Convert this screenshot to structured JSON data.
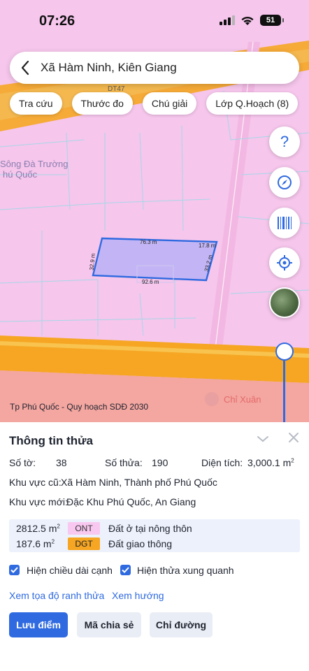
{
  "status": {
    "time": "07:26",
    "battery": "51"
  },
  "search": {
    "text": "Xã Hàm Ninh, Kiên Giang"
  },
  "toolbar": {
    "chips": [
      "Tra cứu",
      "Thước đo",
      "Chú giải",
      "Lớp Q.Hoạch (8)"
    ]
  },
  "map": {
    "road_label": "DT47",
    "area_label_1": "Sông Đà Trường",
    "area_label_2": "hú Quốc",
    "parcel_top": "76.3 m",
    "parcel_top_right": "17.8 m",
    "parcel_left": "32.9 m",
    "parcel_right": "33.2 m",
    "parcel_bottom": "92.6 m",
    "caption": "Tp Phú Quốc - Quy hoạch SDĐ 2030",
    "poi": "Chỉ Xuân",
    "colors": {
      "residential": "#f6c6ec",
      "road": "#f6a623",
      "zone": "#f4a6a0",
      "parcel": "#2f6ae0"
    }
  },
  "panel": {
    "title": "Thông tin thửa",
    "so_to_label": "Số tờ:",
    "so_to_value": "38",
    "so_thua_label": "Số thửa:",
    "so_thua_value": "190",
    "dien_tich_label": "Diện tích:",
    "dien_tich_value": "3,000.1 m",
    "dien_tich_unit_sup": "2",
    "khu_vuc_cu_label": "Khu vực cũ:",
    "khu_vuc_cu_value": "Xã Hàm Ninh, Thành phố Phú Quốc",
    "khu_vuc_moi_label": "Khu vực mới:",
    "khu_vuc_moi_value": "Đặc Khu Phú Quốc, An Giang",
    "land_uses": [
      {
        "area": "2812.5 m",
        "sup": "2",
        "code": "ONT",
        "desc": "Đất ở tại nông thôn",
        "badge_bg": "#f8c8f0",
        "badge_color": "#333333"
      },
      {
        "area": "187.6 m",
        "sup": "2",
        "code": "DGT",
        "desc": "Đất giao thông",
        "badge_bg": "#f6a623",
        "badge_color": "#222222"
      }
    ],
    "checkbox_1": "Hiện chiều dài cạnh",
    "checkbox_2": "Hiện thửa xung quanh",
    "link_1": "Xem tọa độ ranh thửa",
    "link_2": "Xem hướng",
    "btn_save": "Lưu điểm",
    "btn_share": "Mã chia sẻ",
    "btn_route": "Chỉ đường"
  }
}
